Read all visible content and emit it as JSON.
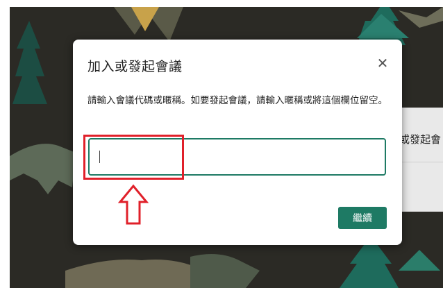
{
  "background": {
    "right_card_text": "或發起會"
  },
  "dialog": {
    "title": "加入或發起會議",
    "close_symbol": "✕",
    "description": "請輸入會議代碼或暱稱。如要發起會議，請輸入暱稱或將這個欄位留空。",
    "input": {
      "value": "",
      "placeholder": ""
    },
    "continue_label": "繼續"
  },
  "colors": {
    "accent": "#1e7a64",
    "annotation": "#e0202a",
    "background": "#2b2a25"
  }
}
